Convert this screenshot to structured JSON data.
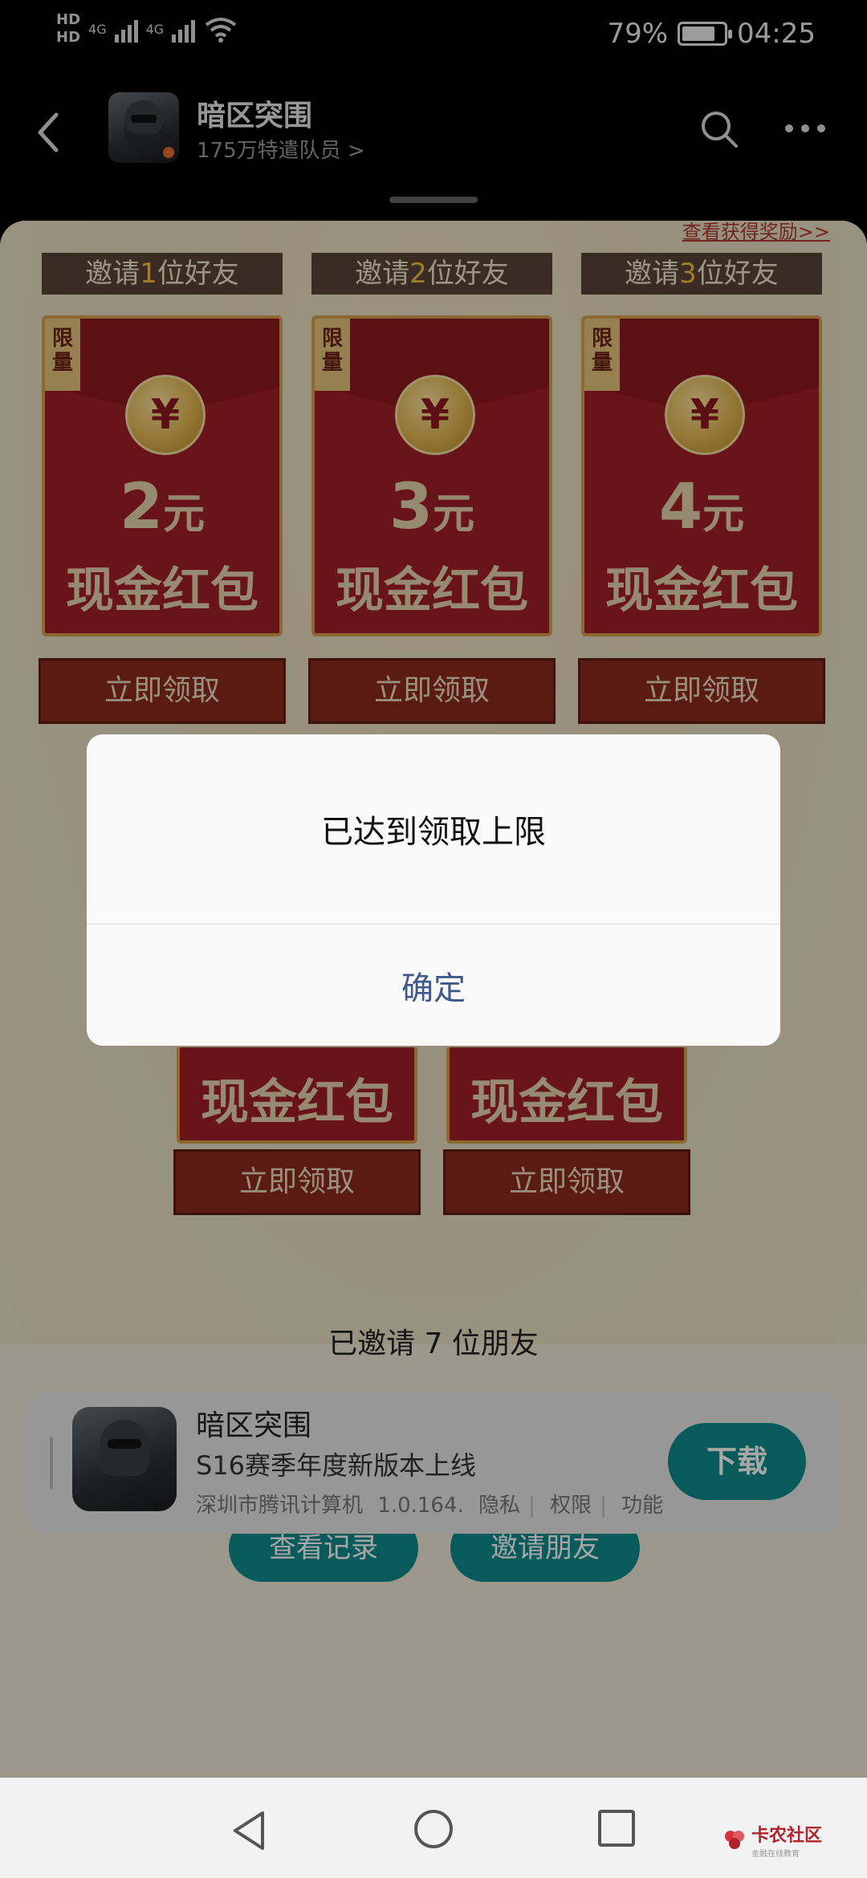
{
  "status_bar": {
    "hd1": "HD",
    "hd2": "HD",
    "network1": "4G",
    "network2": "4G",
    "battery_percent": "79%",
    "battery_level": 0.79,
    "time": "04:25"
  },
  "header": {
    "title": "暗区突围",
    "subtitle": "175万特遣队员 >"
  },
  "rewards": {
    "view_rewards_link": "查看获得奖励>>",
    "limit_label": "限量",
    "coin_symbol": "¥",
    "claim_label": "立即领取",
    "cash_label": "现金红包",
    "tiers": [
      {
        "prefix": "邀请",
        "count": "1",
        "suffix": "位好友",
        "amount": "2",
        "unit": "元"
      },
      {
        "prefix": "邀请",
        "count": "2",
        "suffix": "位好友",
        "amount": "3",
        "unit": "元"
      },
      {
        "prefix": "邀请",
        "count": "3",
        "suffix": "位好友",
        "amount": "4",
        "unit": "元"
      }
    ]
  },
  "friends": {
    "invited_text": "已邀请 7 位朋友",
    "more_label": "···",
    "view_records_label": "查看记录",
    "invite_label": "邀请朋友"
  },
  "dialog": {
    "message": "已达到领取上限",
    "confirm_label": "确定"
  },
  "app_card": {
    "title": "暗区突围",
    "description": "S16赛季年度新版本上线",
    "developer": "深圳市腾讯计算机",
    "version": "1.0.164.",
    "privacy": "隐私",
    "permissions": "权限",
    "features": "功能",
    "download_label": "下载"
  },
  "watermark": {
    "name": "卡农社区",
    "tagline": "金融在线教育"
  }
}
